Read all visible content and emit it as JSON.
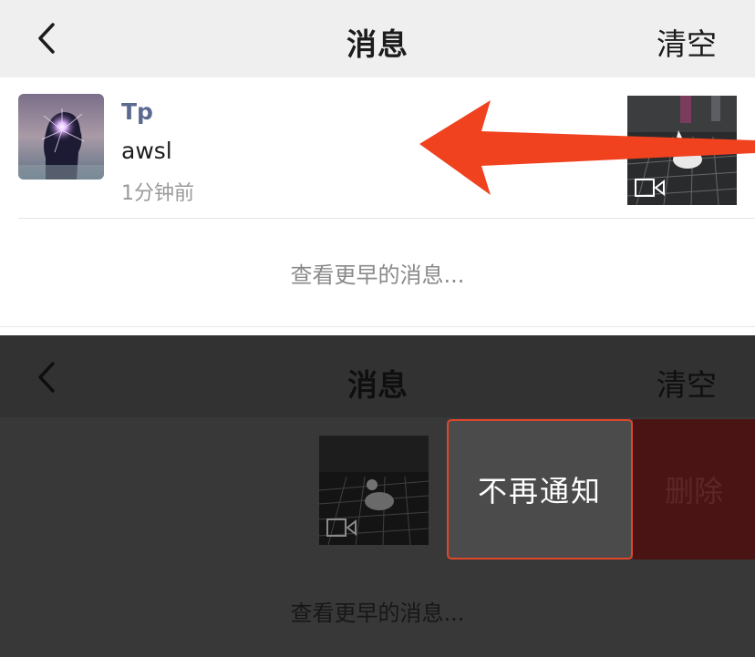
{
  "header": {
    "back_icon": "chevron-left-icon",
    "title": "消息",
    "clear_label": "清空"
  },
  "message": {
    "avatar": "avatar-image",
    "username": "Tp",
    "text": "awsl",
    "time": "1分钟前",
    "thumbnail": "video-thumbnail",
    "thumbnail_badge_icon": "video-camera-icon"
  },
  "see_earlier": "查看更早的消息...",
  "annotation": {
    "icon": "red-arrow-left-icon",
    "color": "#f0421f"
  },
  "swipe_actions": {
    "mute_label": "不再通知",
    "delete_label": "删除",
    "mute_color": "#4b4b4b",
    "delete_color": "#4a1414",
    "highlight_color": "#e2462a"
  },
  "colors": {
    "username": "#5b6a8f",
    "navbar": "#efefef",
    "overlay": "#383838"
  }
}
